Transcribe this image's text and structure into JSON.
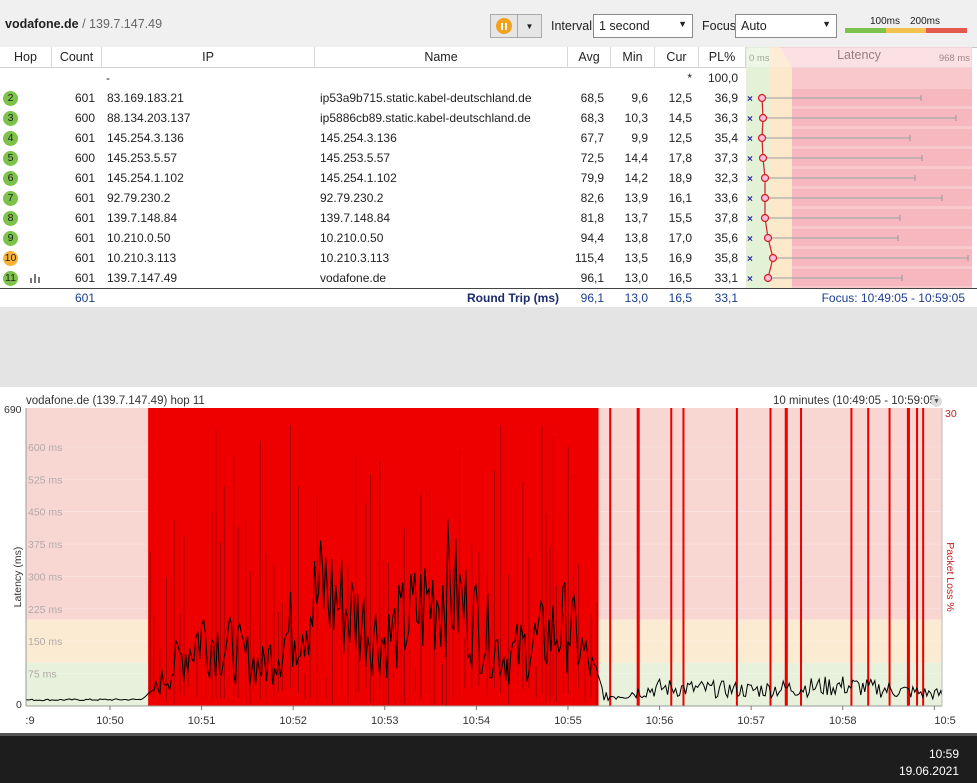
{
  "toolbar": {
    "target_name": "vodafone.de",
    "separator": " / ",
    "target_ip": "139.7.147.49",
    "interval_label": "Interval",
    "interval_value": "1 second",
    "focus_label": "Focus",
    "focus_value": "Auto",
    "scale_low": "100ms",
    "scale_high": "200ms",
    "scale_colors": [
      "#7dc24a",
      "#f2c14e",
      "#e45a4f"
    ]
  },
  "table": {
    "headers": {
      "hop": "Hop",
      "count": "Count",
      "ip": "IP",
      "name": "Name",
      "avg": "Avg",
      "min": "Min",
      "cur": "Cur",
      "pl": "PL%",
      "lat_min": "0 ms",
      "lat": "Latency",
      "lat_max": "968 ms"
    },
    "first_row": {
      "ip": "-",
      "cur": "*",
      "pl": "100,0"
    },
    "rows": [
      {
        "hop": "2",
        "count": "601",
        "ip": "83.169.183.21",
        "name": "ip53a9b715.static.kabel-deutschland.de",
        "avg": "68,5",
        "min": "9,6",
        "cur": "12,5",
        "pl": "36,9",
        "status": "ok"
      },
      {
        "hop": "3",
        "count": "600",
        "ip": "88.134.203.137",
        "name": "ip5886cb89.static.kabel-deutschland.de",
        "avg": "68,3",
        "min": "10,3",
        "cur": "14,5",
        "pl": "36,3",
        "status": "ok"
      },
      {
        "hop": "4",
        "count": "601",
        "ip": "145.254.3.136",
        "name": "145.254.3.136",
        "avg": "67,7",
        "min": "9,9",
        "cur": "12,5",
        "pl": "35,4",
        "status": "ok"
      },
      {
        "hop": "5",
        "count": "600",
        "ip": "145.253.5.57",
        "name": "145.253.5.57",
        "avg": "72,5",
        "min": "14,4",
        "cur": "17,8",
        "pl": "37,3",
        "status": "ok"
      },
      {
        "hop": "6",
        "count": "601",
        "ip": "145.254.1.102",
        "name": "145.254.1.102",
        "avg": "79,9",
        "min": "14,2",
        "cur": "18,9",
        "pl": "32,3",
        "status": "ok"
      },
      {
        "hop": "7",
        "count": "601",
        "ip": "92.79.230.2",
        "name": "92.79.230.2",
        "avg": "82,6",
        "min": "13,9",
        "cur": "16,1",
        "pl": "33,6",
        "status": "ok"
      },
      {
        "hop": "8",
        "count": "601",
        "ip": "139.7.148.84",
        "name": "139.7.148.84",
        "avg": "81,8",
        "min": "13,7",
        "cur": "15,5",
        "pl": "37,8",
        "status": "ok"
      },
      {
        "hop": "9",
        "count": "601",
        "ip": "10.210.0.50",
        "name": "10.210.0.50",
        "avg": "94,4",
        "min": "13,8",
        "cur": "17,0",
        "pl": "35,6",
        "status": "ok"
      },
      {
        "hop": "10",
        "count": "601",
        "ip": "10.210.3.113",
        "name": "10.210.3.113",
        "avg": "115,4",
        "min": "13,5",
        "cur": "16,9",
        "pl": "35,8",
        "status": "warn"
      },
      {
        "hop": "11",
        "count": "601",
        "ip": "139.7.147.49",
        "name": "vodafone.de",
        "avg": "96,1",
        "min": "13,0",
        "cur": "16,5",
        "pl": "33,1",
        "status": "ok"
      }
    ],
    "summary": {
      "count": "601",
      "label": "Round Trip (ms)",
      "avg": "96,1",
      "min": "13,0",
      "cur": "16,5",
      "pl": "33,1",
      "focus_text": "Focus: 10:49:05 - 10:59:05"
    }
  },
  "graph": {
    "title": "vodafone.de (139.7.147.49) hop 11",
    "range": "10 minutes (10:49:05 - 10:59:05)",
    "y_axis_label": "Latency (ms)",
    "right_axis_label": "Packet Loss %",
    "y_max_label": "690",
    "y_min_label": "0",
    "right_max_label": "30",
    "y_ticks": [
      "600 ms",
      "525 ms",
      "450 ms",
      "375 ms",
      "300 ms",
      "225 ms",
      "150 ms",
      "75 ms"
    ],
    "x_ticks": [
      ":9",
      "10:50",
      "10:51",
      "10:52",
      "10:53",
      "10:54",
      "10:55",
      "10:56",
      "10:57",
      "10:58",
      "10:5"
    ]
  },
  "chart_data": {
    "type": "area",
    "title": "vodafone.de (139.7.147.49) hop 11",
    "xlabel": "",
    "ylabel": "Latency (ms)",
    "y2label": "Packet Loss %",
    "ylim": [
      0,
      690
    ],
    "y2lim": [
      0,
      30
    ],
    "x_range": [
      "10:49:05",
      "10:59:05"
    ],
    "bands_ms": [
      {
        "from": 0,
        "to": 100,
        "color": "#e7f1dc"
      },
      {
        "from": 100,
        "to": 200,
        "color": "#fbebd2"
      },
      {
        "from": 200,
        "to": 690,
        "color": "#f8d6d2"
      }
    ],
    "loss_color": "#ee0000",
    "packet_loss_periods": [
      [
        "10:50:25",
        "10:55:20"
      ],
      [
        "10:55:27",
        "10:55:28"
      ],
      [
        "10:55:45",
        "10:55:47"
      ],
      [
        "10:56:07",
        "10:56:08"
      ],
      [
        "10:56:15",
        "10:56:16"
      ],
      [
        "10:56:50",
        "10:56:51"
      ],
      [
        "10:57:12",
        "10:57:13"
      ],
      [
        "10:57:22",
        "10:57:24"
      ],
      [
        "10:57:32",
        "10:57:33"
      ],
      [
        "10:58:05",
        "10:58:06"
      ],
      [
        "10:58:16",
        "10:58:17"
      ],
      [
        "10:58:30",
        "10:58:31"
      ],
      [
        "10:58:42",
        "10:58:44"
      ],
      [
        "10:58:48",
        "10:58:49"
      ],
      [
        "10:58:52",
        "10:58:53"
      ]
    ],
    "latency_series": [
      {
        "time": "10:49:05",
        "ms": 14
      },
      {
        "time": "10:50:20",
        "ms": 15
      },
      {
        "time": "10:50:30",
        "ms": 40
      },
      {
        "time": "10:51:00",
        "ms": 170
      },
      {
        "time": "10:51:40",
        "ms": 90
      },
      {
        "time": "10:52:20",
        "ms": 270
      },
      {
        "time": "10:53:00",
        "ms": 150
      },
      {
        "time": "10:53:40",
        "ms": 280
      },
      {
        "time": "10:54:20",
        "ms": 110
      },
      {
        "time": "10:55:00",
        "ms": 190
      },
      {
        "time": "10:55:25",
        "ms": 20
      },
      {
        "time": "10:56:00",
        "ms": 40
      },
      {
        "time": "10:57:00",
        "ms": 35
      },
      {
        "time": "10:58:00",
        "ms": 45
      },
      {
        "time": "10:59:05",
        "ms": 25
      }
    ]
  },
  "taskbar": {
    "time": "10:59",
    "date": "19.06.2021"
  }
}
